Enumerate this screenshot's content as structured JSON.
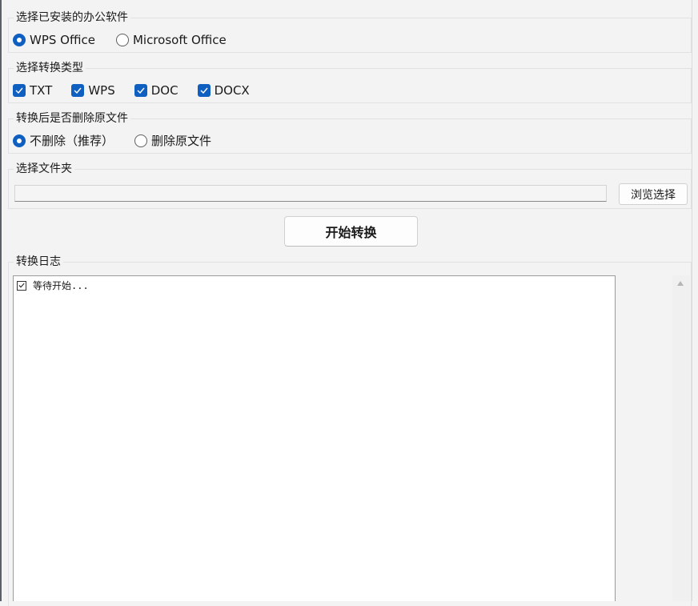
{
  "office_group": {
    "title": "选择已安装的办公软件",
    "options": [
      {
        "label": "WPS Office",
        "selected": true
      },
      {
        "label": "Microsoft Office",
        "selected": false
      }
    ]
  },
  "type_group": {
    "title": "选择转换类型",
    "options": [
      {
        "label": "TXT",
        "checked": true
      },
      {
        "label": "WPS",
        "checked": true
      },
      {
        "label": "DOC",
        "checked": true
      },
      {
        "label": "DOCX",
        "checked": true
      }
    ]
  },
  "delete_group": {
    "title": "转换后是否删除原文件",
    "options": [
      {
        "label": "不删除（推荐）",
        "selected": true
      },
      {
        "label": "删除原文件",
        "selected": false
      }
    ]
  },
  "folder_group": {
    "title": "选择文件夹",
    "path_value": "",
    "browse_label": "浏览选择"
  },
  "start_button": {
    "label": "开始转换"
  },
  "log_group": {
    "title": "转换日志",
    "lines": [
      {
        "text": "等待开始..."
      }
    ]
  },
  "colors": {
    "accent": "#0f5fc1",
    "background": "#f3f3f3"
  }
}
